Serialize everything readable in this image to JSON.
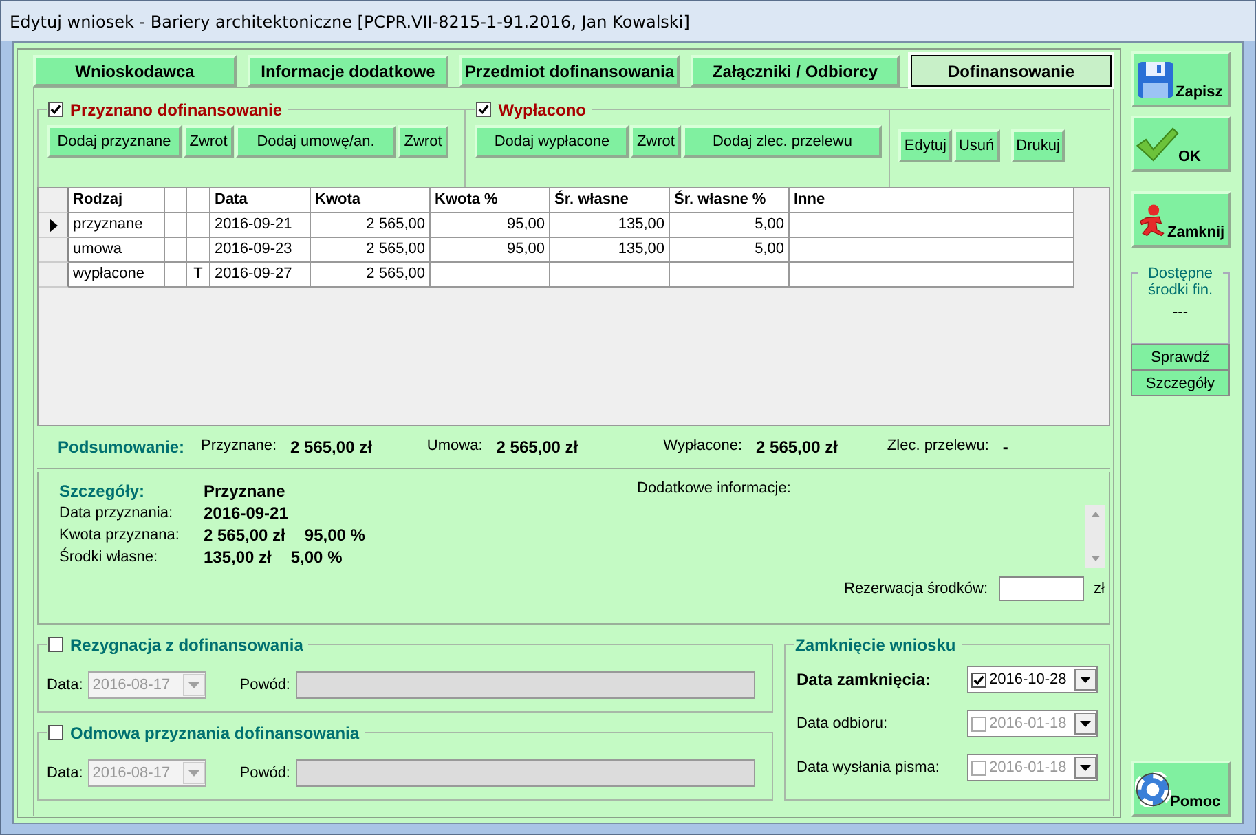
{
  "window": {
    "title": "Edytuj wniosek - Bariery architektoniczne  [PCPR.VII-8215-1-91.2016, Jan Kowalski]"
  },
  "tabs": [
    {
      "label": "Wnioskodawca",
      "selected": false
    },
    {
      "label": "Informacje dodatkowe",
      "selected": false
    },
    {
      "label": "Przedmiot dofinansowania",
      "selected": false
    },
    {
      "label": "Załączniki / Odbiorcy",
      "selected": false
    },
    {
      "label": "Dofinansowanie",
      "selected": true
    }
  ],
  "przyznano": {
    "label": "Przyznano dofinansowanie",
    "checked": true,
    "buttons": [
      "Dodaj przyznane",
      "Zwrot",
      "Dodaj umowę/an.",
      "Zwrot"
    ]
  },
  "wyplacono": {
    "label": "Wypłacono",
    "checked": true,
    "buttons": [
      "Dodaj wypłacone",
      "Zwrot",
      "Dodaj zlec. przelewu"
    ]
  },
  "actions": [
    "Edytuj",
    "Usuń",
    "Drukuj"
  ],
  "table": {
    "columns": [
      "Rodzaj",
      "Data",
      "Kwota",
      "Kwota %",
      "Śr. własne",
      "Śr. własne %",
      "Inne"
    ],
    "rows": [
      {
        "current": true,
        "rodzaj": "przyznane",
        "data": "2016-09-21",
        "kwota": "2 565,00",
        "kwota_pct": "95,00",
        "sr_wlasne": "135,00",
        "sr_wlasne_pct": "5,00"
      },
      {
        "current": false,
        "rodzaj": "umowa",
        "data": "2016-09-23",
        "kwota": "2 565,00",
        "kwota_pct": "95,00",
        "sr_wlasne": "135,00",
        "sr_wlasne_pct": "5,00"
      },
      {
        "current": false,
        "rodzaj": "wypłacone",
        "flag": "T",
        "data": "2016-09-27",
        "kwota": "2 565,00"
      }
    ]
  },
  "summary": {
    "label": "Podsumowanie:",
    "items": [
      {
        "label": "Przyznane:",
        "value": "2 565,00 zł"
      },
      {
        "label": "Umowa:",
        "value": "2 565,00 zł"
      },
      {
        "label": "Wypłacone:",
        "value": "2 565,00 zł"
      },
      {
        "label": "Zlec. przelewu:",
        "value": "-"
      }
    ]
  },
  "details": {
    "label": "Szczegóły:",
    "title": "Przyznane",
    "rows": [
      {
        "label": "Data przyznania:",
        "values": [
          "2016-09-21"
        ]
      },
      {
        "label": "Kwota przyznana:",
        "values": [
          "2 565,00 zł",
          "95,00 %"
        ]
      },
      {
        "label": "Środki własne:",
        "values": [
          "135,00 zł",
          "5,00 %"
        ]
      }
    ],
    "info_label": "Dodatkowe informacje:",
    "reservation_label": "Rezerwacja środków:",
    "reservation_unit": "zł"
  },
  "rezygnacja": {
    "label": "Rezygnacja z dofinansowania",
    "checked": false,
    "date_label": "Data:",
    "date": "2016-08-17",
    "reason_label": "Powód:"
  },
  "odmowa": {
    "label": "Odmowa przyznania dofinansowania",
    "checked": false,
    "date_label": "Data:",
    "date": "2016-08-17",
    "reason_label": "Powód:"
  },
  "zamkniecie": {
    "label": "Zamknięcie wniosku",
    "rows": [
      {
        "label": "Data zamknięcia:",
        "checked": true,
        "date": "2016-10-28"
      },
      {
        "label": "Data odbioru:",
        "checked": false,
        "date": "2016-01-18"
      },
      {
        "label": "Data wysłania pisma:",
        "checked": false,
        "date": "2016-01-18"
      }
    ]
  },
  "side": {
    "buttons": [
      {
        "kind": "save",
        "label": "Zapisz"
      },
      {
        "kind": "ok",
        "label": "OK"
      },
      {
        "kind": "close",
        "label": "Zamknij"
      }
    ],
    "funds_label": "Dostępne środki fin.",
    "funds_value": "---",
    "funds_buttons": [
      "Sprawdź",
      "Szczegóły"
    ],
    "help": {
      "kind": "help",
      "label": "Pomoc"
    }
  }
}
